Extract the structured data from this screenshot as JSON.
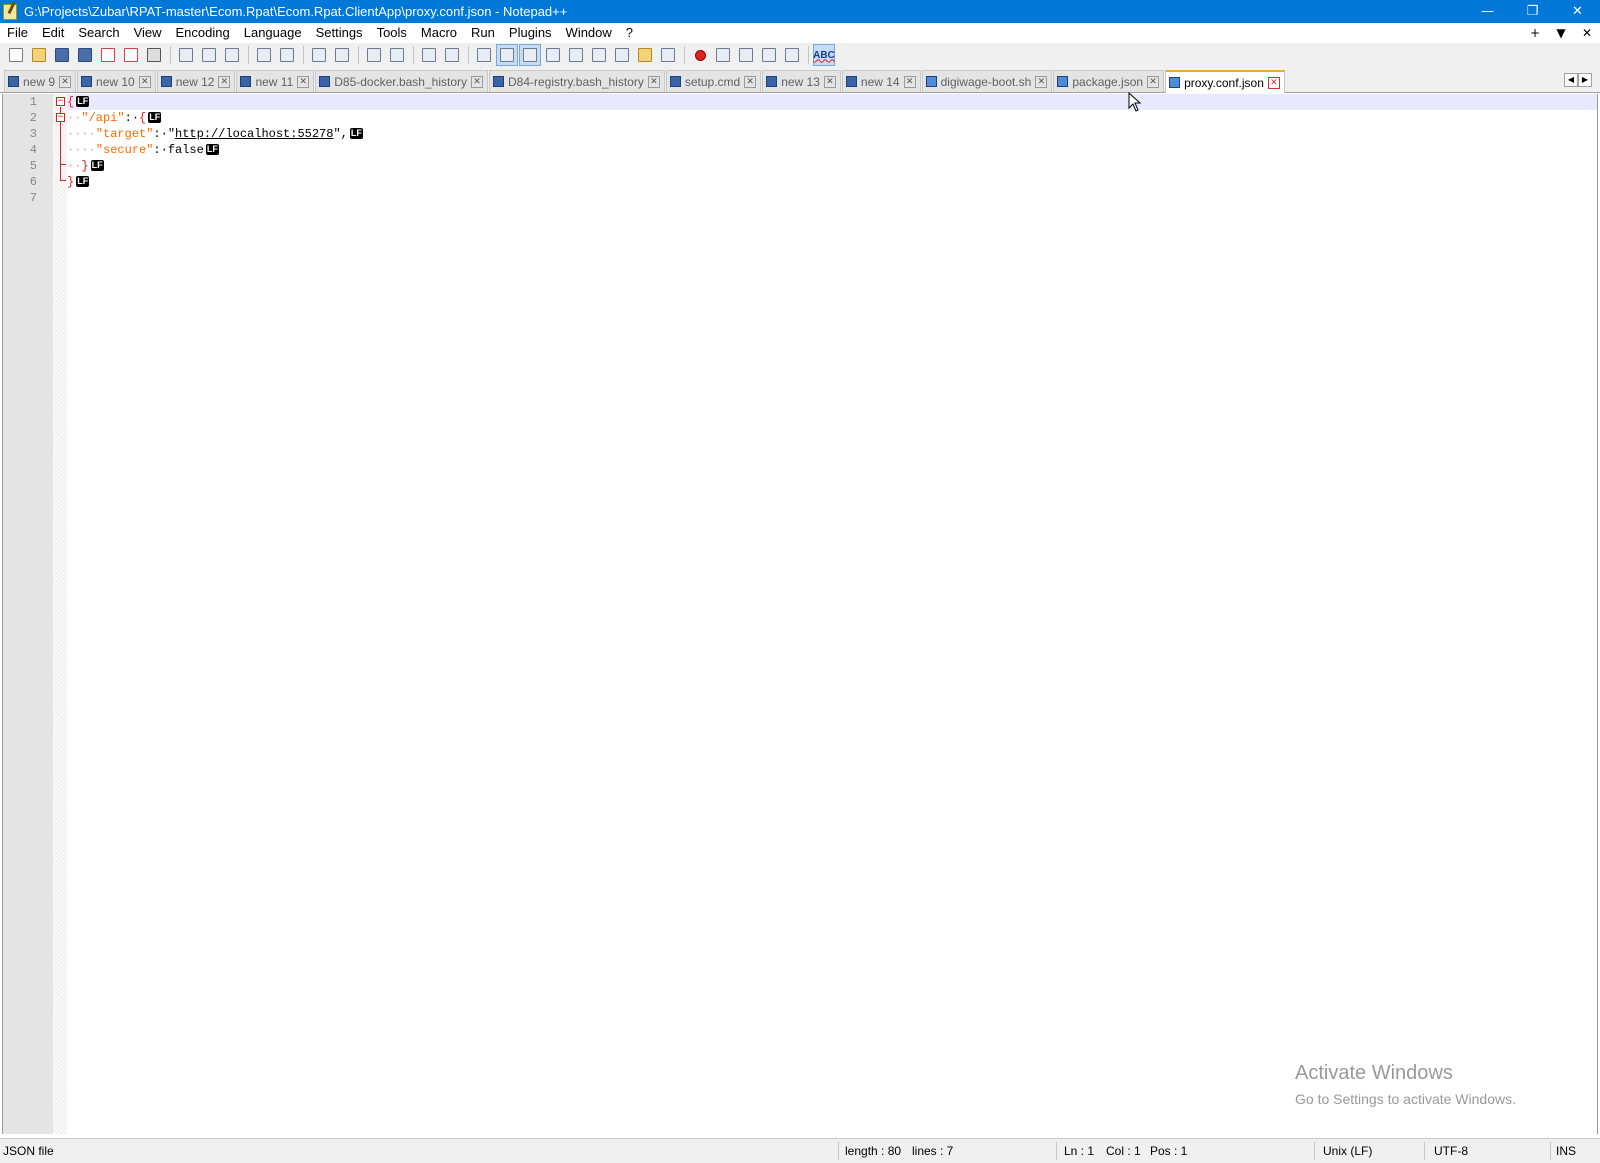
{
  "titlebar": {
    "title": "G:\\Projects\\Zubar\\RPAT-master\\Ecom.Rpat\\Ecom.Rpat.ClientApp\\proxy.conf.json - Notepad++",
    "minimize": "—",
    "maximize": "❐",
    "close": "✕"
  },
  "menu": {
    "items": [
      "File",
      "Edit",
      "Search",
      "View",
      "Encoding",
      "Language",
      "Settings",
      "Tools",
      "Macro",
      "Run",
      "Plugins",
      "Window",
      "?"
    ],
    "right": [
      "+",
      "▼",
      "✕"
    ]
  },
  "toolbar": {
    "spellcheck_label": "ABC"
  },
  "tabs": [
    {
      "label": "new 9",
      "active": false
    },
    {
      "label": "new 10",
      "active": false
    },
    {
      "label": "new 12",
      "active": false
    },
    {
      "label": "new 11",
      "active": false
    },
    {
      "label": "D85-docker.bash_history",
      "active": false
    },
    {
      "label": "D84-registry.bash_history",
      "active": false
    },
    {
      "label": "setup.cmd",
      "active": false
    },
    {
      "label": "new 13",
      "active": false
    },
    {
      "label": "new 14",
      "active": false
    },
    {
      "label": "digiwage-boot.sh",
      "active": false
    },
    {
      "label": "package.json",
      "active": false
    },
    {
      "label": "proxy.conf.json",
      "active": true
    }
  ],
  "tab_close_glyph": "✕",
  "tab_scroll": {
    "left": "◀",
    "right": "▶"
  },
  "editor": {
    "line_numbers": [
      "1",
      "2",
      "3",
      "4",
      "5",
      "6",
      "7"
    ],
    "eol_marker": "LF",
    "lines": {
      "l1": {
        "brace": "{"
      },
      "l2": {
        "indent": "··",
        "key": "\"/api\"",
        "colon": ":·",
        "brace": "{"
      },
      "l3": {
        "indent": "····",
        "key": "\"target\"",
        "colon": ":·",
        "q1": "\"",
        "url": "http://localhost:55278",
        "q2": "\",",
        "trail": ""
      },
      "l4": {
        "indent": "····",
        "key": "\"secure\"",
        "colon": ":·",
        "value": "false"
      },
      "l5": {
        "indent": "··",
        "brace": "}"
      },
      "l6": {
        "brace": "}"
      }
    },
    "fold_minus": "−"
  },
  "watermark": {
    "title": "Activate Windows",
    "subtitle": "Go to Settings to activate Windows."
  },
  "status": {
    "file_type": "JSON file",
    "length": "length : 80",
    "lines": "lines : 7",
    "ln": "Ln : 1",
    "col": "Col : 1",
    "pos": "Pos : 1",
    "eol": "Unix (LF)",
    "encoding": "UTF-8",
    "mode": "INS"
  },
  "colors": {
    "titlebar": "#0078d7",
    "active_tab_accent": "#f5a623",
    "json_key": "#ff6a00",
    "brace": "#e02020",
    "current_line": "#e8e8ff"
  }
}
